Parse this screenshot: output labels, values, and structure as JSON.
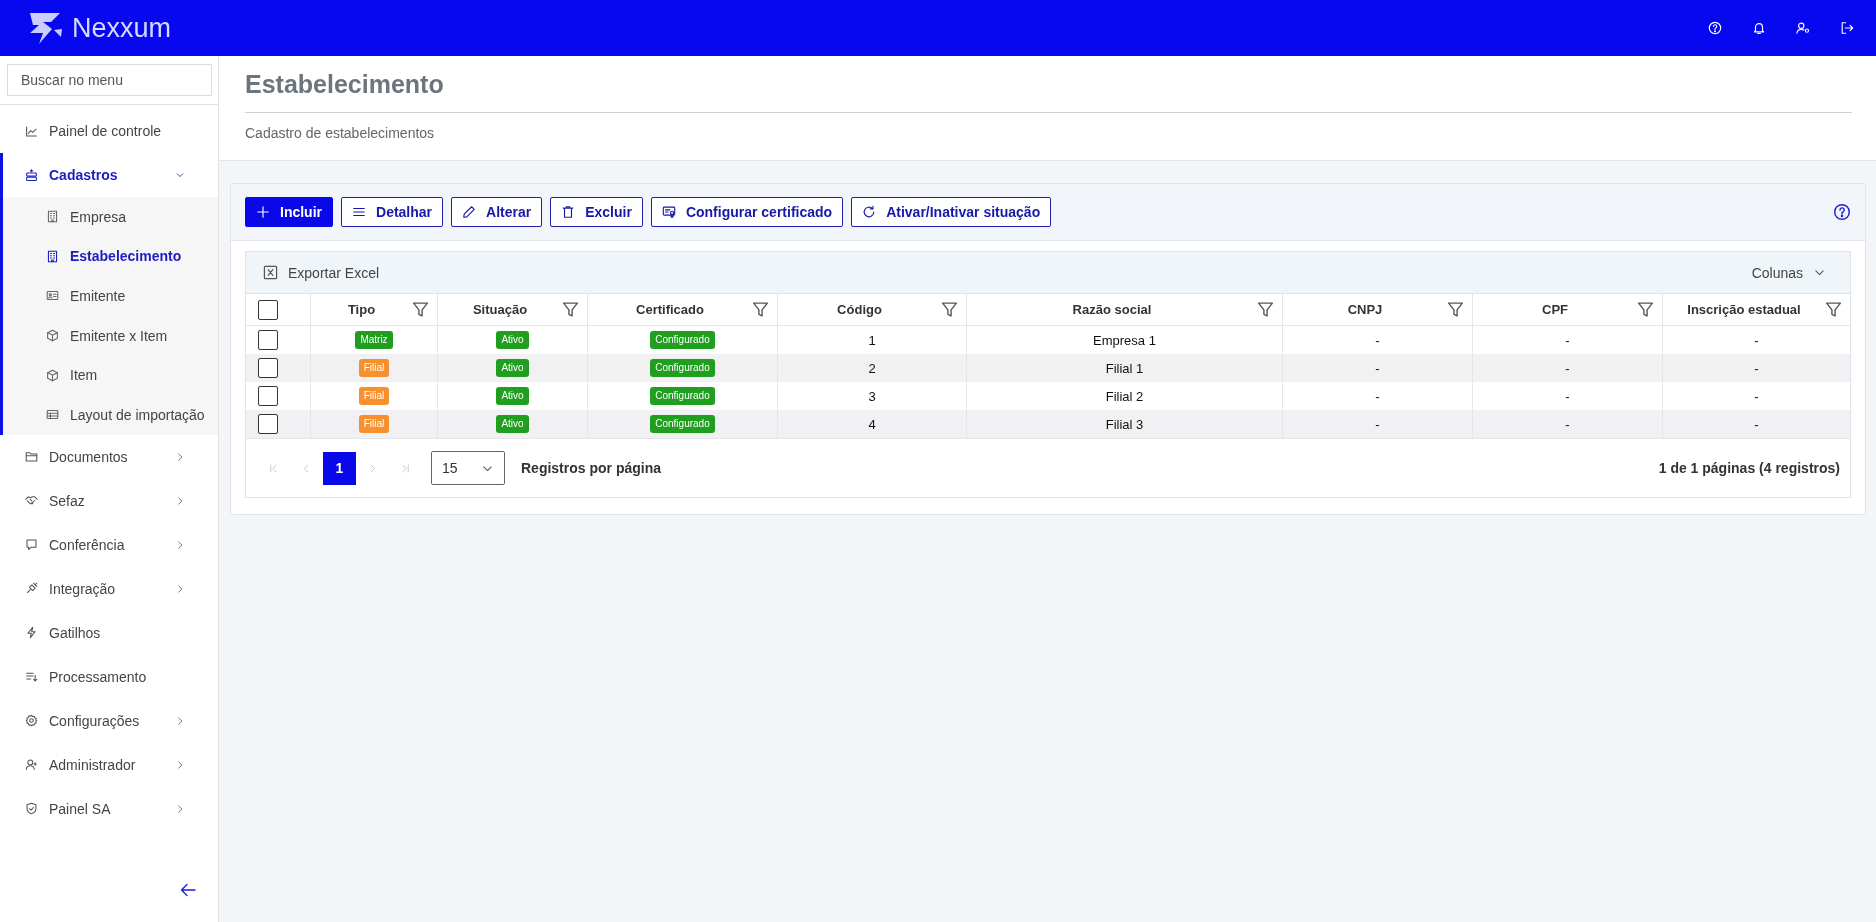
{
  "header": {
    "logo": "Nexxum"
  },
  "sidebar": {
    "search": {
      "placeholder": "Buscar no menu"
    },
    "items": [
      {
        "label": "Painel de controle",
        "expandable": false,
        "expanded": false
      },
      {
        "label": "Cadastros",
        "expandable": true,
        "expanded": true,
        "children": [
          {
            "label": "Empresa",
            "selected": false
          },
          {
            "label": "Estabelecimento",
            "selected": true
          },
          {
            "label": "Emitente",
            "selected": false
          },
          {
            "label": "Emitente x Item",
            "selected": false
          },
          {
            "label": "Item",
            "selected": false
          },
          {
            "label": "Layout de importação",
            "selected": false
          }
        ]
      },
      {
        "label": "Documentos",
        "expandable": true,
        "expanded": false
      },
      {
        "label": "Sefaz",
        "expandable": true,
        "expanded": false
      },
      {
        "label": "Conferência",
        "expandable": true,
        "expanded": false
      },
      {
        "label": "Integração",
        "expandable": true,
        "expanded": false
      },
      {
        "label": "Gatilhos",
        "expandable": false,
        "expanded": false
      },
      {
        "label": "Processamento",
        "expandable": false,
        "expanded": false
      },
      {
        "label": "Configurações",
        "expandable": true,
        "expanded": false
      },
      {
        "label": "Administrador",
        "expandable": true,
        "expanded": false
      },
      {
        "label": "Painel SA",
        "expandable": true,
        "expanded": false
      }
    ]
  },
  "page": {
    "title": "Estabelecimento",
    "subtitle": "Cadastro de estabelecimentos"
  },
  "toolbar": {
    "buttons": [
      {
        "label": "Incluir",
        "kind": "primary"
      },
      {
        "label": "Detalhar",
        "kind": "secondary"
      },
      {
        "label": "Alterar",
        "kind": "secondary"
      },
      {
        "label": "Excluir",
        "kind": "secondary"
      },
      {
        "label": "Configurar certificado",
        "kind": "secondary"
      },
      {
        "label": "Ativar/Inativar situação",
        "kind": "secondary"
      }
    ]
  },
  "grid": {
    "export": "Exportar Excel",
    "columns_menu": "Colunas",
    "select_all": {
      "checked": false
    },
    "columns": [
      "Tipo",
      "Situação",
      "Certificado",
      "Código",
      "Razão social",
      "CNPJ",
      "CPF",
      "Inscrição estadual"
    ],
    "rows": [
      {
        "checked": false,
        "cells": [
          {
            "kind": "tag",
            "text": "Matriz",
            "color": "#1f9e1f"
          },
          {
            "kind": "tag",
            "text": "Ativo",
            "color": "#1f9e1f"
          },
          {
            "kind": "tag",
            "text": "Configurado",
            "color": "#1f9e1f"
          },
          {
            "kind": "text",
            "text": "1"
          },
          {
            "kind": "text",
            "text": "Empresa 1"
          },
          {
            "kind": "text",
            "text": "-"
          },
          {
            "kind": "text",
            "text": "-"
          },
          {
            "kind": "text",
            "text": "-"
          }
        ]
      },
      {
        "checked": false,
        "cells": [
          {
            "kind": "tag",
            "text": "Filial",
            "color": "#f7902e"
          },
          {
            "kind": "tag",
            "text": "Ativo",
            "color": "#1f9e1f"
          },
          {
            "kind": "tag",
            "text": "Configurado",
            "color": "#1f9e1f"
          },
          {
            "kind": "text",
            "text": "2"
          },
          {
            "kind": "text",
            "text": "Filial 1"
          },
          {
            "kind": "text",
            "text": "-"
          },
          {
            "kind": "text",
            "text": "-"
          },
          {
            "kind": "text",
            "text": "-"
          }
        ]
      },
      {
        "checked": false,
        "cells": [
          {
            "kind": "tag",
            "text": "Filial",
            "color": "#f7902e"
          },
          {
            "kind": "tag",
            "text": "Ativo",
            "color": "#1f9e1f"
          },
          {
            "kind": "tag",
            "text": "Configurado",
            "color": "#1f9e1f"
          },
          {
            "kind": "text",
            "text": "3"
          },
          {
            "kind": "text",
            "text": "Filial 2"
          },
          {
            "kind": "text",
            "text": "-"
          },
          {
            "kind": "text",
            "text": "-"
          },
          {
            "kind": "text",
            "text": "-"
          }
        ]
      },
      {
        "checked": false,
        "cells": [
          {
            "kind": "tag",
            "text": "Filial",
            "color": "#f7902e"
          },
          {
            "kind": "tag",
            "text": "Ativo",
            "color": "#1f9e1f"
          },
          {
            "kind": "tag",
            "text": "Configurado",
            "color": "#1f9e1f"
          },
          {
            "kind": "text",
            "text": "4"
          },
          {
            "kind": "text",
            "text": "Filial 3"
          },
          {
            "kind": "text",
            "text": "-"
          },
          {
            "kind": "text",
            "text": "-"
          },
          {
            "kind": "text",
            "text": "-"
          }
        ]
      }
    ]
  },
  "pager": {
    "nav": [
      {
        "kind": "first",
        "disabled": true
      },
      {
        "kind": "prev",
        "disabled": true
      },
      {
        "kind": "next",
        "disabled": true
      },
      {
        "kind": "last",
        "disabled": true
      }
    ],
    "pages": [
      {
        "label": "1",
        "selected": true
      }
    ],
    "page_size": "15",
    "page_size_label": "Registros por página",
    "summary": "1 de 1 páginas (4 registros)"
  }
}
